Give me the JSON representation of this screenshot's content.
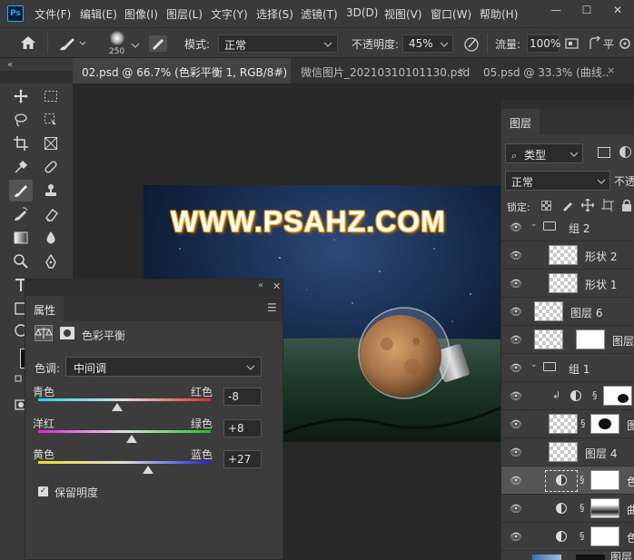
{
  "app": {
    "logo": "Ps"
  },
  "menu": [
    "文件(F)",
    "编辑(E)",
    "图像(I)",
    "图层(L)",
    "文字(Y)",
    "选择(S)",
    "滤镜(T)",
    "3D(D)",
    "视图(V)",
    "窗口(W)",
    "帮助(H)"
  ],
  "window_controls": {
    "minimize": "—",
    "maximize": "☐",
    "close": "✕"
  },
  "options": {
    "brush_size": "250",
    "mode_label": "模式:",
    "mode_value": "正常",
    "opacity_label": "不透明度:",
    "opacity_value": "45%",
    "flow_label": "流量:",
    "flow_value": "100%",
    "smooth_label": "平"
  },
  "tabs": [
    {
      "label": "02.psd @ 66.7% (色彩平衡 1, RGB/8#) *",
      "active": true
    },
    {
      "label": "微信图片_20210310101130.psd",
      "active": false
    },
    {
      "label": "05.psd @ 33.3% (曲线...",
      "active": false
    }
  ],
  "tab_close": "×",
  "document": {
    "watermark": "WWW.PSAHZ.COM"
  },
  "properties": {
    "panel_title": "属性",
    "adjustment_name": "色彩平衡",
    "tone_label": "色调:",
    "tone_value": "中间调",
    "sliders": [
      {
        "left": "青色",
        "right": "红色",
        "value": "-8",
        "amount": -8
      },
      {
        "left": "洋红",
        "right": "绿色",
        "value": "+8",
        "amount": 8
      },
      {
        "left": "黄色",
        "right": "蓝色",
        "value": "+27",
        "amount": 27
      }
    ],
    "preserve_label": "保留明度",
    "preserve_checked": true
  },
  "layers": {
    "panel_title": "图层",
    "filter_label": "类型",
    "blend_mode": "正常",
    "opacity_short": "不透",
    "lock_label": "锁定:",
    "rows": [
      {
        "name": "组 2",
        "kind": "group"
      },
      {
        "name": "形状 2",
        "kind": "smart"
      },
      {
        "name": "形状 1",
        "kind": "smart"
      },
      {
        "name": "图层 6",
        "kind": "smart"
      },
      {
        "name": "图层",
        "kind": "smart-mask"
      },
      {
        "name": "组 1",
        "kind": "group"
      },
      {
        "name": "",
        "kind": "adjust-clip"
      },
      {
        "name": "图",
        "kind": "smart-mask"
      },
      {
        "name": "图层 4",
        "kind": "smart"
      },
      {
        "name": "色",
        "kind": "adjust-selected"
      },
      {
        "name": "曲",
        "kind": "adjust"
      },
      {
        "name": "色",
        "kind": "adjust"
      },
      {
        "name": "图层",
        "kind": "photo"
      }
    ]
  },
  "colors": {
    "accent": "#31a8ff",
    "panel": "#3c3c3c",
    "bar": "#3a3a3a"
  }
}
